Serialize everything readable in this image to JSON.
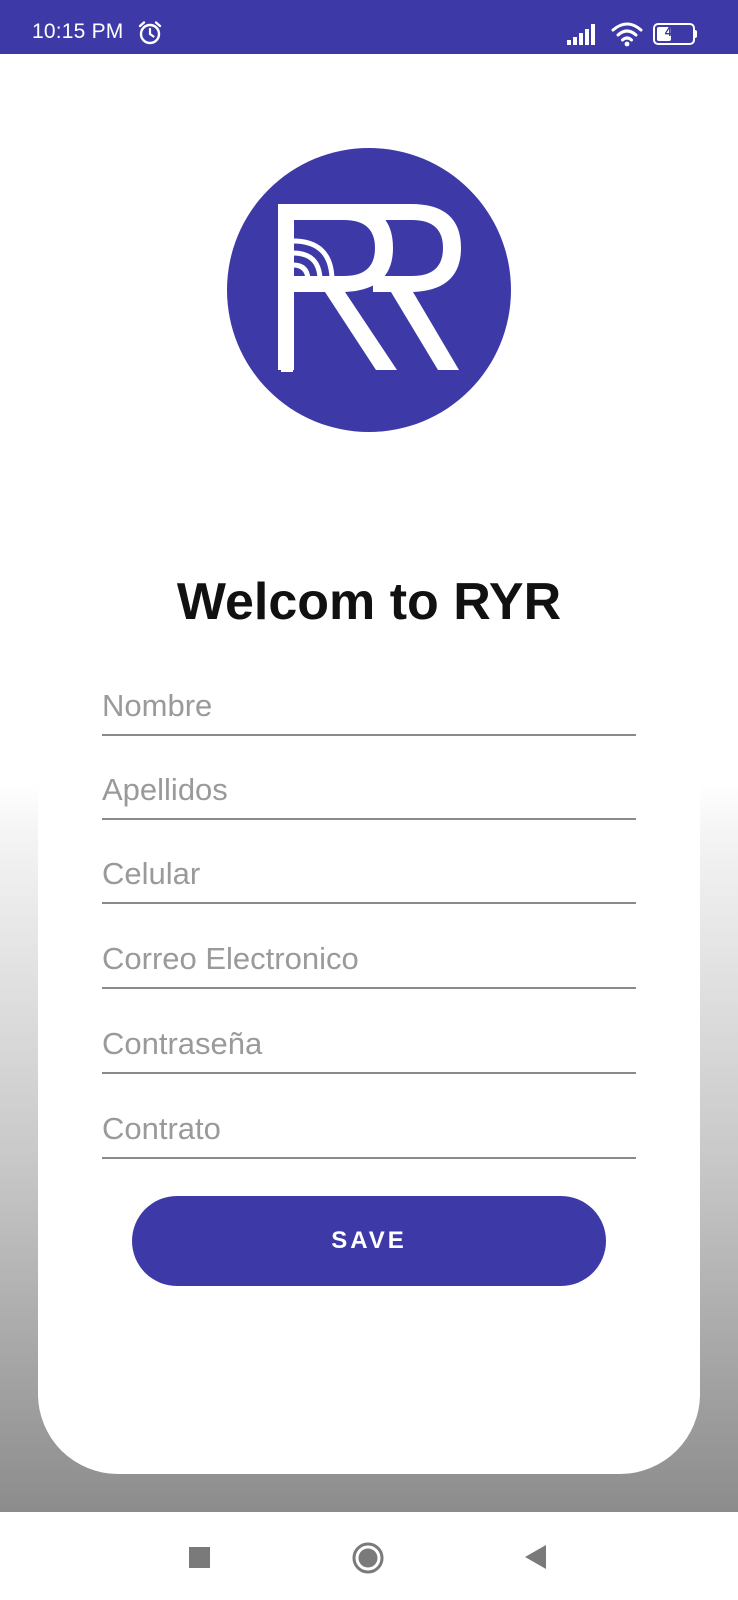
{
  "status_bar": {
    "time": "10:15 PM",
    "alarm_icon": "alarm-clock-icon",
    "signal_icon": "cellular-signal-icon",
    "wifi_icon": "wifi-icon",
    "battery_icon": "battery-icon",
    "battery_level": "40",
    "battery_fraction": 0.4,
    "background_color": "#3d3aa8"
  },
  "logo": {
    "description_icon": "ryr-logo-icon",
    "color": "#3d3aa8"
  },
  "title": "Welcom to RYR",
  "form": {
    "fields": [
      {
        "placeholder": "Nombre",
        "value": ""
      },
      {
        "placeholder": "Apellidos",
        "value": ""
      },
      {
        "placeholder": "Celular",
        "value": ""
      },
      {
        "placeholder": "Correo Electronico",
        "value": ""
      },
      {
        "placeholder": "Contraseña",
        "value": ""
      },
      {
        "placeholder": "Contrato",
        "value": ""
      }
    ],
    "save_label": "SAVE",
    "accent_color": "#3d3aa8"
  },
  "nav_bar": {
    "recents_icon": "square-recents-icon",
    "home_icon": "circle-home-icon",
    "back_icon": "triangle-back-icon"
  }
}
